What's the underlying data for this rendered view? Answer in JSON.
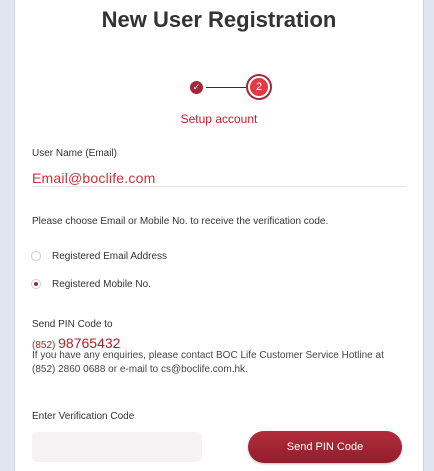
{
  "title": "New User Registration",
  "steps": {
    "step2_number": "2",
    "current_label": "Setup account"
  },
  "fields": {
    "username_label": "User Name (Email)",
    "username_value": "Email@boclife.com"
  },
  "verification": {
    "instruction": "Please choose Email or Mobile No. to receive the verification code.",
    "options": [
      {
        "label": "Registered Email Address",
        "selected": false
      },
      {
        "label": "Registered Mobile No.",
        "selected": true
      }
    ]
  },
  "pin": {
    "send_to_label": "Send PIN Code to",
    "country_code": "(852)",
    "number": "98765432",
    "info_text": "If you have any enquiries, please contact BOC Life Customer Service Hotline at (852) 2860 0688 or e-mail to cs@boclife.com.hk."
  },
  "code": {
    "label": "Enter Verification Code",
    "value": "",
    "send_button": "Send PIN Code"
  },
  "colors": {
    "accent": "#a3283a",
    "accent_text": "#c0202f",
    "page_background": "#dfe5ee"
  }
}
